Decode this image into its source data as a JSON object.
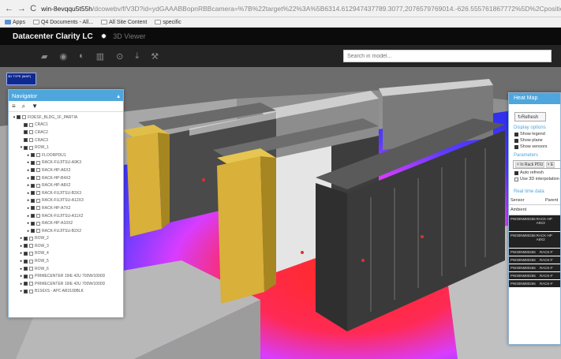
{
  "browser": {
    "url_host": "win-8evqqu5t55h",
    "url_path": "/dcowebv/f/V3D?id=ydGAAABBopnRBBcamera=%7B%22target%22%3A%5B6314.612947437789.3077,2076579769014.-626.555761867772%5D%2Cposition%22%3A-54.6644506870939.104",
    "bookmarks": [
      "Apps",
      "Q4 Documents - All...",
      "All Site Content",
      "specific"
    ]
  },
  "app": {
    "title": "Datacenter Clarity LC",
    "view": "3D Viewer",
    "search_placeholder": "Search in model..."
  },
  "toolbar": {
    "tools": [
      "folder-icon",
      "camera-icon",
      "filter-icon",
      "bars-icon",
      "target-icon",
      "download-icon",
      "wrench-icon"
    ]
  },
  "minimap": {
    "label": "3D TYPE (MAP)"
  },
  "navigator": {
    "title": "Navigator",
    "collapse_glyph": "▴",
    "tools": [
      "≡",
      "⌕",
      "▼"
    ],
    "items": [
      {
        "label": "FIDESF_BLDG_1F_PARTIA",
        "depth": 0,
        "expanded": true,
        "has_children": true
      },
      {
        "label": "CRAC1",
        "depth": 1,
        "expanded": false,
        "has_children": false
      },
      {
        "label": "CRAC2",
        "depth": 1,
        "expanded": false,
        "has_children": false
      },
      {
        "label": "CRAC3",
        "depth": 1,
        "expanded": false,
        "has_children": false
      },
      {
        "label": "ROW_1",
        "depth": 1,
        "expanded": true,
        "has_children": true
      },
      {
        "label": "FLOORPDU1",
        "depth": 2,
        "expanded": false,
        "has_children": true
      },
      {
        "label": "RACK-FUJITSU-A9K3",
        "depth": 2,
        "expanded": false,
        "has_children": true
      },
      {
        "label": "RACK-HP-A6X2",
        "depth": 2,
        "expanded": false,
        "has_children": true
      },
      {
        "label": "RACK-HP-B4X2",
        "depth": 2,
        "expanded": false,
        "has_children": true
      },
      {
        "label": "RACK-HP-A8X2",
        "depth": 2,
        "expanded": false,
        "has_children": true
      },
      {
        "label": "RACK-FUJITSU-B3X3",
        "depth": 2,
        "expanded": false,
        "has_children": true
      },
      {
        "label": "RACK-FUJITSU-A12X3",
        "depth": 2,
        "expanded": false,
        "has_children": true
      },
      {
        "label": "RACK-HP-A7X2",
        "depth": 2,
        "expanded": false,
        "has_children": true
      },
      {
        "label": "RACK-FUJITSU-A11X2",
        "depth": 2,
        "expanded": false,
        "has_children": true
      },
      {
        "label": "RACK-HP-A10X2",
        "depth": 2,
        "expanded": false,
        "has_children": true
      },
      {
        "label": "RACK-FUJITSU-B2X2",
        "depth": 2,
        "expanded": false,
        "has_children": true
      },
      {
        "label": "ROW_2",
        "depth": 1,
        "expanded": false,
        "has_children": true
      },
      {
        "label": "ROW_3",
        "depth": 1,
        "expanded": false,
        "has_children": true
      },
      {
        "label": "ROW_4",
        "depth": 1,
        "expanded": false,
        "has_children": true
      },
      {
        "label": "ROW_5",
        "depth": 1,
        "expanded": false,
        "has_children": true
      },
      {
        "label": "ROW_6",
        "depth": 1,
        "expanded": false,
        "has_children": true
      },
      {
        "label": "PRIMECENTER 19IE 42U 700W/1000D",
        "depth": 1,
        "expanded": false,
        "has_children": true
      },
      {
        "label": "PRIMECENTER 19IE 42U 700W/1000D",
        "depth": 1,
        "expanded": false,
        "has_children": true
      },
      {
        "label": "B1S6XS - APC AR3100BLK",
        "depth": 1,
        "expanded": false,
        "has_children": true
      }
    ]
  },
  "heatmap": {
    "title": "Heat Map",
    "refresh_label": "Refresh",
    "display_title": "Display options",
    "display_options": [
      "Show legend",
      "Show plane",
      "Show sensors"
    ],
    "parameters_title": "Parameters",
    "parameter_chip": "× In Rack PDU",
    "parameter_chip2": "× E",
    "param_options": [
      "Auto refresh",
      "Use 3D interpolation"
    ],
    "realtime_title": "Real time data",
    "col_sensor": "Sensor",
    "col_parent": "Parent",
    "ambient": "Ambient",
    "rows": [
      {
        "sensor": "PW30NM80256",
        "parent": "RACK-HP A9X3"
      },
      {
        "sensor": "PW30NM80256",
        "parent": "RACK-HP A8X2"
      },
      {
        "sensor": "PW30NM80256",
        "parent": "RACK-F"
      },
      {
        "sensor": "PW30NM80256",
        "parent": "RACK-F"
      },
      {
        "sensor": "PW30NM80256",
        "parent": "RACK-F"
      },
      {
        "sensor": "PW30NM80256",
        "parent": "RACK-F"
      },
      {
        "sensor": "PW30NM80256",
        "parent": "RACK-F"
      }
    ]
  },
  "scene": {
    "colors": {
      "rack_dark": "#3a3a3a",
      "rack_yellow": "#d8b03a",
      "heat_red": "#ff2a2a",
      "heat_magenta": "#d03cff",
      "heat_blue": "#3a3aff"
    }
  }
}
